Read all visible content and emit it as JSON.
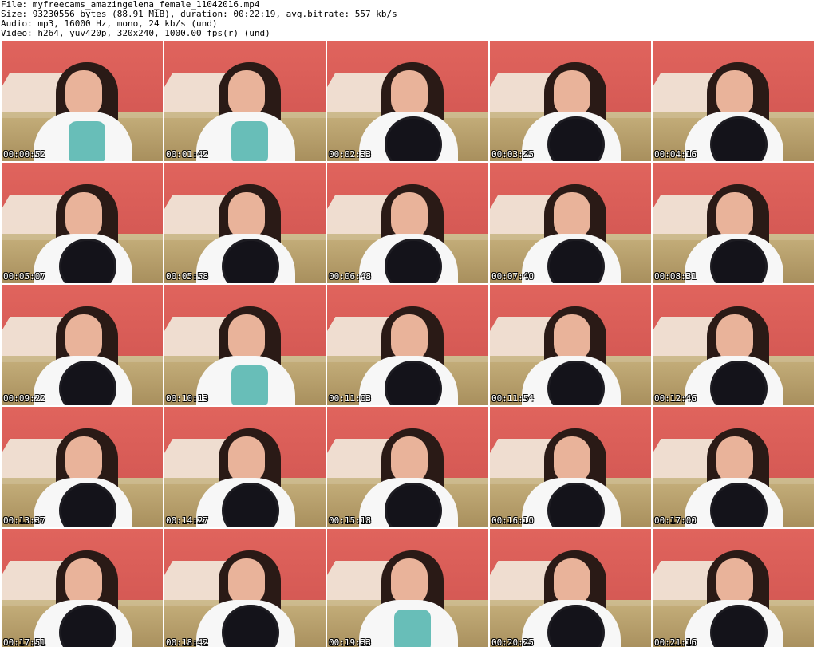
{
  "header": {
    "file": "File: myfreecams_amazingelena_female_11042016.mp4",
    "size": "Size: 93230556 bytes (88.91 MiB), duration: 00:22:19, avg.bitrate: 557 kb/s",
    "audio": "Audio: mp3, 16000 Hz, mono, 24 kb/s (und)",
    "video": "Video: h264, yuv420p, 320x240, 1000.00 fps(r) (und)"
  },
  "thumbnails": [
    {
      "time": "00:00:52"
    },
    {
      "time": "00:01:42"
    },
    {
      "time": "00:02:33"
    },
    {
      "time": "00:03:25"
    },
    {
      "time": "00:04:16"
    },
    {
      "time": "00:05:07"
    },
    {
      "time": "00:05:58"
    },
    {
      "time": "00:06:48"
    },
    {
      "time": "00:07:40"
    },
    {
      "time": "00:08:31"
    },
    {
      "time": "00:09:22"
    },
    {
      "time": "00:10:13"
    },
    {
      "time": "00:11:03"
    },
    {
      "time": "00:11:54"
    },
    {
      "time": "00:12:46"
    },
    {
      "time": "00:13:37"
    },
    {
      "time": "00:14:27"
    },
    {
      "time": "00:15:18"
    },
    {
      "time": "00:16:10"
    },
    {
      "time": "00:17:00"
    },
    {
      "time": "00:17:51"
    },
    {
      "time": "00:18:42"
    },
    {
      "time": "00:19:33"
    },
    {
      "time": "00:20:25"
    },
    {
      "time": "00:21:16"
    }
  ]
}
